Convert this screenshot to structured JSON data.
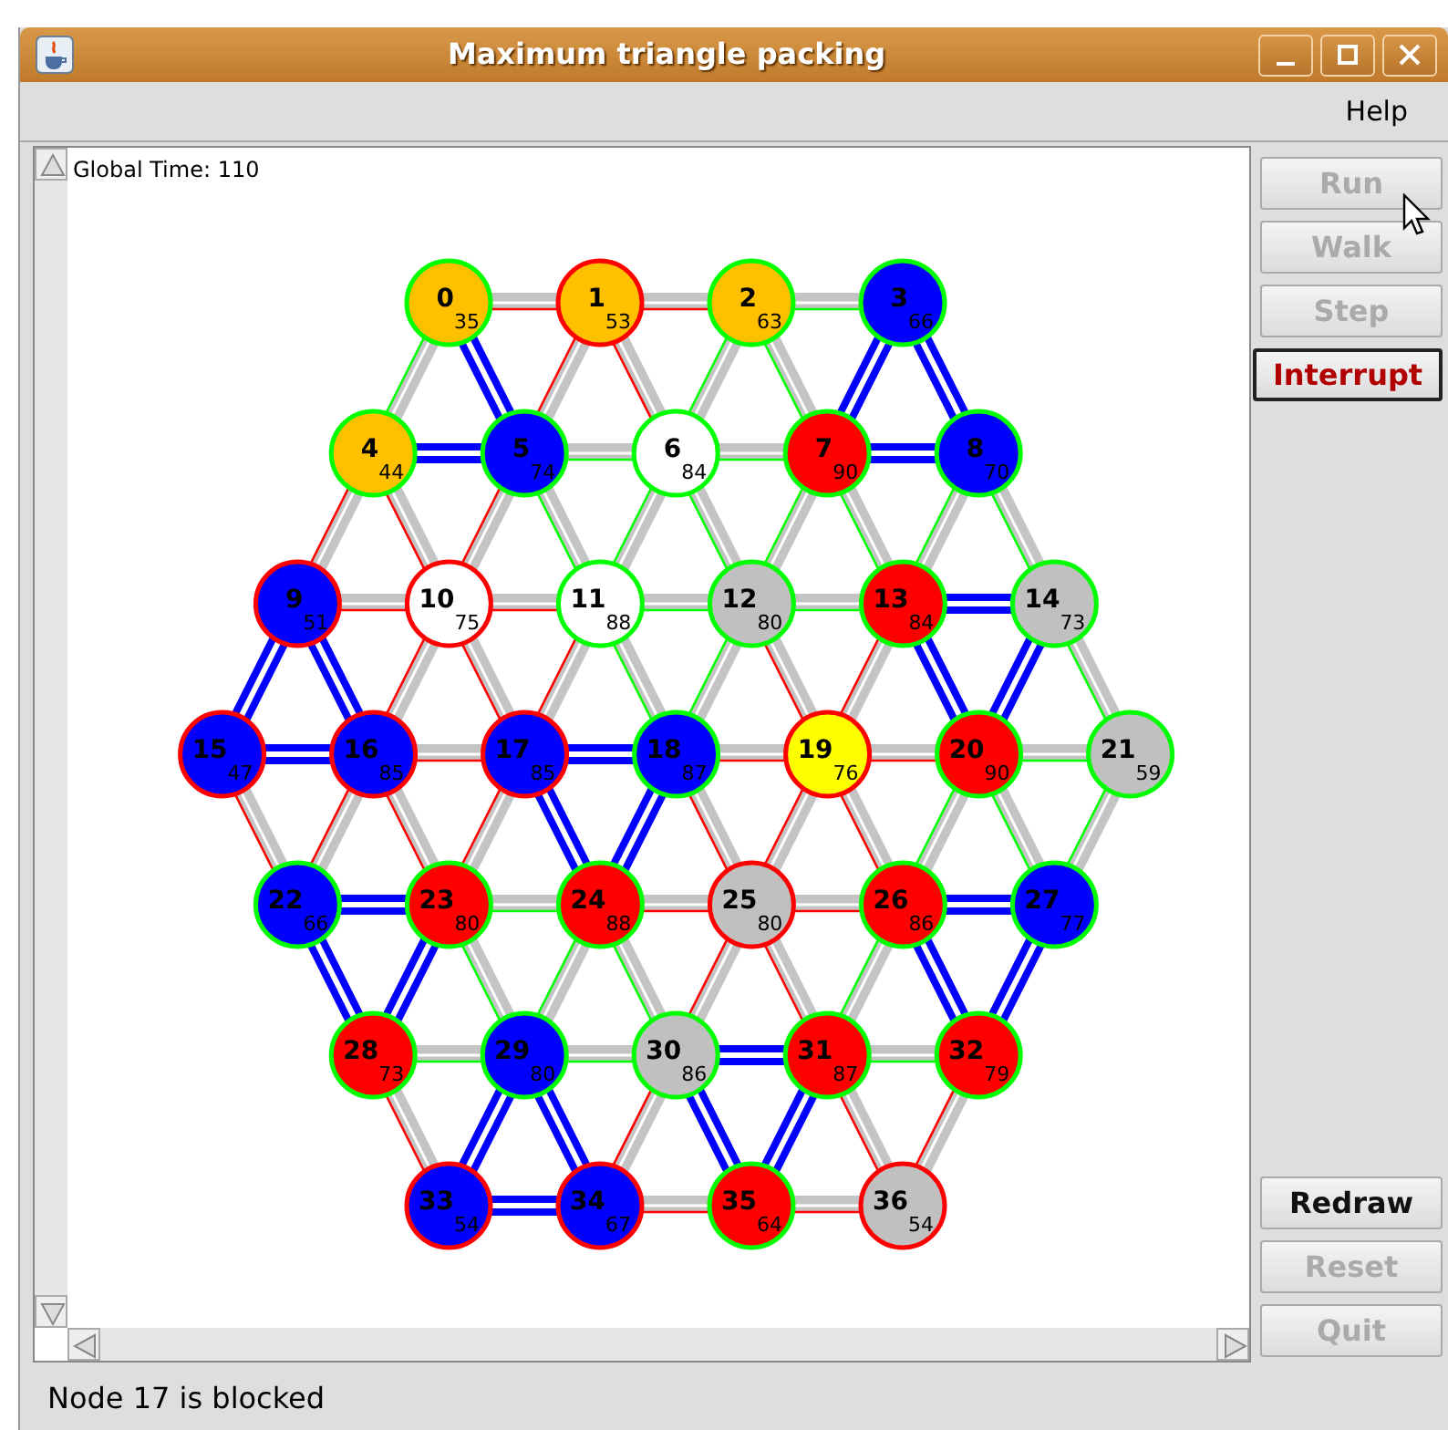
{
  "window": {
    "title": "Maximum triangle packing"
  },
  "menu": [
    "Help"
  ],
  "canvas": {
    "global_time": "Global Time: 110",
    "rows": [
      [
        {
          "label": "0",
          "value": "35",
          "color": "#ffc000",
          "alert": false,
          "packed_right": false,
          "packed_down_left": false,
          "packed_down_right": true
        },
        {
          "label": "1",
          "value": "53",
          "color": "#ffc000",
          "alert": true,
          "packed_right": false,
          "packed_down_left": false,
          "packed_down_right": false
        },
        {
          "label": "2",
          "value": "63",
          "color": "#ffc000",
          "alert": false,
          "packed_right": false,
          "packed_down_left": false,
          "packed_down_right": false
        },
        {
          "label": "3",
          "value": "66",
          "color": "#0000ff",
          "alert": false,
          "packed_down_left": true,
          "packed_down_right": true
        }
      ],
      [
        {
          "label": "4",
          "value": "44",
          "color": "#ffc000",
          "alert": false,
          "packed_right": true,
          "packed_down_left": false,
          "packed_down_right": false
        },
        {
          "label": "5",
          "value": "74",
          "color": "#0000ff",
          "alert": false,
          "packed_right": false,
          "packed_down_left": false,
          "packed_down_right": false
        },
        {
          "label": "6",
          "value": "84",
          "color": "#ffffff",
          "alert": false,
          "packed_right": false,
          "packed_down_left": false,
          "packed_down_right": false
        },
        {
          "label": "7",
          "value": "90",
          "color": "#ff0000",
          "alert": false,
          "packed_right": true,
          "packed_down_left": false,
          "packed_down_right": false
        },
        {
          "label": "8",
          "value": "70",
          "color": "#0000ff",
          "alert": false,
          "packed_down_left": false,
          "packed_down_right": false
        }
      ],
      [
        {
          "label": "9",
          "value": "51",
          "color": "#0000ff",
          "alert": true,
          "packed_right": false,
          "packed_down_left": true,
          "packed_down_right": true
        },
        {
          "label": "10",
          "value": "75",
          "color": "#ffffff",
          "alert": true,
          "packed_right": false,
          "packed_down_left": false,
          "packed_down_right": false
        },
        {
          "label": "11",
          "value": "88",
          "color": "#ffffff",
          "alert": false,
          "packed_right": false,
          "packed_down_left": false,
          "packed_down_right": false
        },
        {
          "label": "12",
          "value": "80",
          "color": "#c0c0c0",
          "alert": false,
          "packed_right": false,
          "packed_down_left": false,
          "packed_down_right": false
        },
        {
          "label": "13",
          "value": "84",
          "color": "#ff0000",
          "alert": false,
          "packed_right": true,
          "packed_down_left": false,
          "packed_down_right": true
        },
        {
          "label": "14",
          "value": "73",
          "color": "#c0c0c0",
          "alert": false,
          "packed_down_left": true,
          "packed_down_right": false
        }
      ],
      [
        {
          "label": "15",
          "value": "47",
          "color": "#0000ff",
          "alert": true,
          "packed_right": true,
          "packed_down_right": false
        },
        {
          "label": "16",
          "value": "85",
          "color": "#0000ff",
          "alert": true,
          "packed_right": false,
          "packed_down_left": false,
          "packed_down_right": false
        },
        {
          "label": "17",
          "value": "85",
          "color": "#0000ff",
          "alert": true,
          "packed_right": true,
          "packed_down_left": false,
          "packed_down_right": true
        },
        {
          "label": "18",
          "value": "87",
          "color": "#0000ff",
          "alert": false,
          "packed_right": false,
          "packed_down_left": true,
          "packed_down_right": false
        },
        {
          "label": "19",
          "value": "76",
          "color": "#ffff00",
          "alert": true,
          "packed_right": false,
          "packed_down_left": false,
          "packed_down_right": false
        },
        {
          "label": "20",
          "value": "90",
          "color": "#ff0000",
          "alert": false,
          "packed_right": false,
          "packed_down_left": false,
          "packed_down_right": false
        },
        {
          "label": "21",
          "value": "59",
          "color": "#c0c0c0",
          "alert": false,
          "packed_down_left": false
        }
      ],
      [
        {
          "label": "22",
          "value": "66",
          "color": "#0000ff",
          "alert": false,
          "packed_right": true,
          "packed_down_right": true
        },
        {
          "label": "23",
          "value": "80",
          "color": "#ff0000",
          "alert": false,
          "packed_right": false,
          "packed_down_left": true,
          "packed_down_right": false
        },
        {
          "label": "24",
          "value": "88",
          "color": "#ff0000",
          "alert": false,
          "packed_right": false,
          "packed_down_left": false,
          "packed_down_right": false
        },
        {
          "label": "25",
          "value": "80",
          "color": "#c0c0c0",
          "alert": true,
          "packed_right": false,
          "packed_down_left": false,
          "packed_down_right": false
        },
        {
          "label": "26",
          "value": "86",
          "color": "#ff0000",
          "alert": false,
          "packed_right": true,
          "packed_down_left": false,
          "packed_down_right": true
        },
        {
          "label": "27",
          "value": "77",
          "color": "#0000ff",
          "alert": false,
          "packed_down_left": true
        }
      ],
      [
        {
          "label": "28",
          "value": "73",
          "color": "#ff0000",
          "alert": false,
          "packed_right": false,
          "packed_down_right": false
        },
        {
          "label": "29",
          "value": "80",
          "color": "#0000ff",
          "alert": false,
          "packed_right": false,
          "packed_down_left": true,
          "packed_down_right": true
        },
        {
          "label": "30",
          "value": "86",
          "color": "#c0c0c0",
          "alert": false,
          "packed_right": true,
          "packed_down_left": false,
          "packed_down_right": true
        },
        {
          "label": "31",
          "value": "87",
          "color": "#ff0000",
          "alert": false,
          "packed_right": false,
          "packed_down_left": true,
          "packed_down_right": false
        },
        {
          "label": "32",
          "value": "79",
          "color": "#ff0000",
          "alert": false,
          "packed_down_left": false
        }
      ],
      [
        {
          "label": "33",
          "value": "54",
          "color": "#0000ff",
          "alert": true,
          "packed_right": true
        },
        {
          "label": "34",
          "value": "67",
          "color": "#0000ff",
          "alert": true,
          "packed_right": false
        },
        {
          "label": "35",
          "value": "64",
          "color": "#ff0000",
          "alert": false,
          "packed_right": false
        },
        {
          "label": "36",
          "value": "54",
          "color": "#c0c0c0",
          "alert": true
        }
      ]
    ]
  },
  "buttons_top": [
    {
      "label": "Run",
      "disabled": true,
      "focused": false,
      "kind": "normal"
    },
    {
      "label": "Walk",
      "disabled": true,
      "focused": false,
      "kind": "normal"
    },
    {
      "label": "Step",
      "disabled": true,
      "focused": false,
      "kind": "normal"
    },
    {
      "label": "Interrupt",
      "disabled": false,
      "focused": true,
      "kind": "danger"
    }
  ],
  "buttons_bottom": [
    {
      "label": "Redraw",
      "disabled": false,
      "focused": false,
      "kind": "normal"
    },
    {
      "label": "Reset",
      "disabled": true,
      "focused": false,
      "kind": "normal"
    },
    {
      "label": "Quit",
      "disabled": true,
      "focused": false,
      "kind": "normal"
    }
  ],
  "status_bar": "Node 17 is blocked"
}
